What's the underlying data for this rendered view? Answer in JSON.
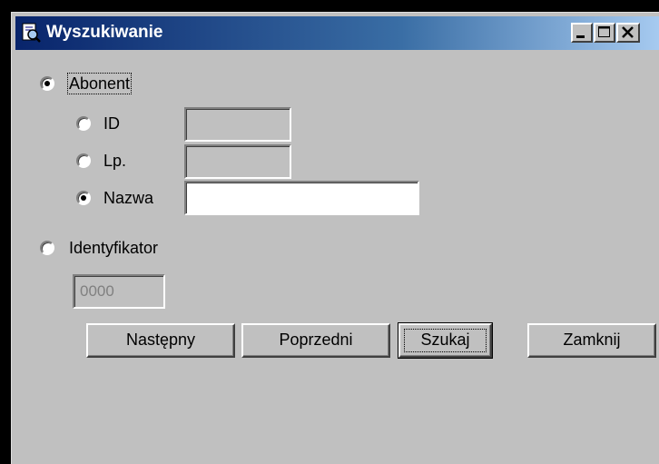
{
  "window": {
    "title": "Wyszukiwanie",
    "title_bar_gradient": [
      "#08246b",
      "#a6caf0"
    ],
    "background": "#c0c0c0"
  },
  "search_mode": {
    "abonent": {
      "label": "Abonent",
      "selected": true
    },
    "identyfikator": {
      "label": "Identyfikator",
      "selected": false
    }
  },
  "abonent_options": {
    "id": {
      "label": "ID",
      "selected": false,
      "value": ""
    },
    "lp": {
      "label": "Lp.",
      "selected": false,
      "value": ""
    },
    "nazwa": {
      "label": "Nazwa",
      "selected": true,
      "value": ""
    }
  },
  "identyfikator_field": {
    "value": "0000"
  },
  "buttons": {
    "next": "Następny",
    "prev": "Poprzedni",
    "search": "Szukaj",
    "close": "Zamknij"
  },
  "icons": {
    "window": "magnifier-document-icon",
    "minimize": "minimize-icon",
    "maximize": "maximize-icon",
    "close": "close-icon"
  }
}
